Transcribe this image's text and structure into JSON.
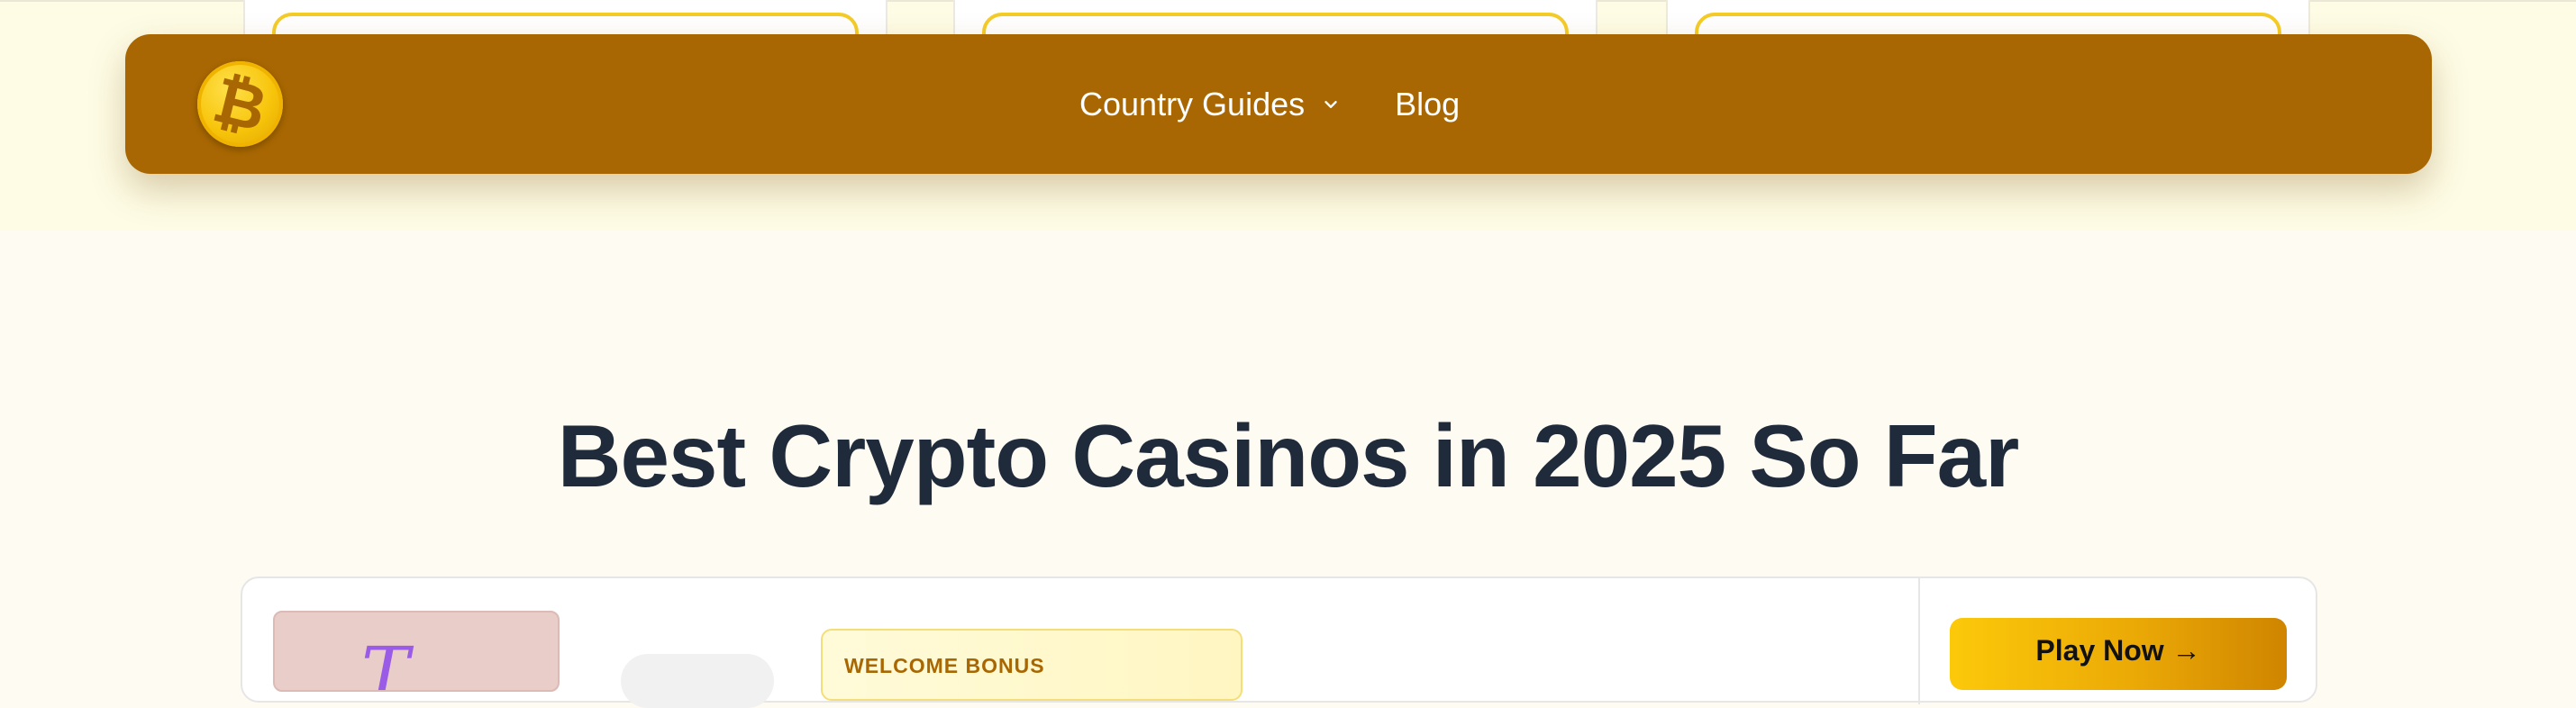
{
  "nav": {
    "logo_symbol": "₿",
    "logo_icon": "bitcoin-icon",
    "items": [
      {
        "label": "Country Guides",
        "has_dropdown": true,
        "dropdown_icon": "chevron-down-icon"
      },
      {
        "label": "Blog",
        "has_dropdown": false
      }
    ]
  },
  "main": {
    "title": "Best Crypto Casinos in 2025 So Far"
  },
  "casino_card": {
    "thumb_letter": "T",
    "bonus_label": "WELCOME BONUS",
    "play_label": "Play Now →"
  },
  "colors": {
    "brand": "#a86702",
    "accent": "#fcc90a",
    "heading": "#1f2a3a",
    "hero_bg": "#fefce5",
    "page_bg": "#fefbf3"
  }
}
